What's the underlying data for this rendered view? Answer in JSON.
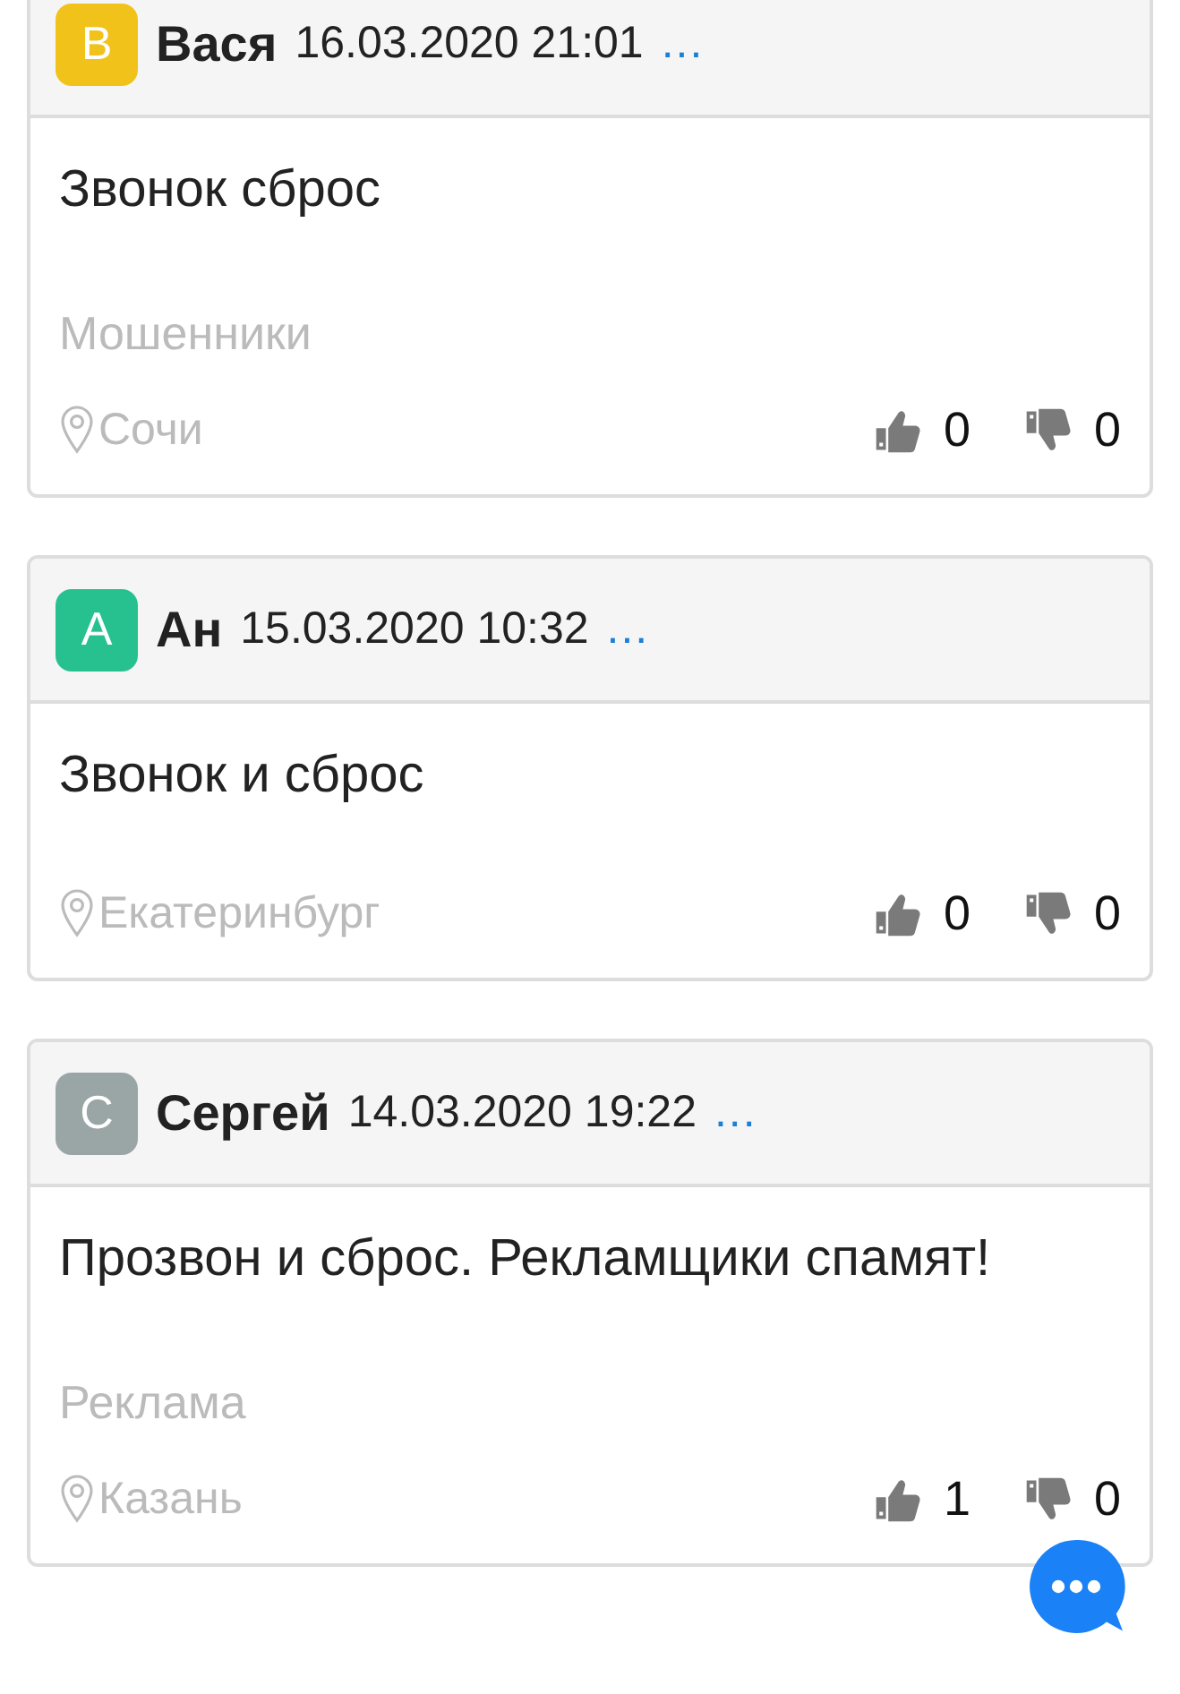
{
  "posts": [
    {
      "author": "Вася",
      "initial": "В",
      "color": "#f0c21a",
      "date": "16.03.2020 21:01",
      "more": "...",
      "text": "Звонок сброс",
      "category": "Мошенники",
      "location": "Сочи",
      "likes": "0",
      "dislikes": "0"
    },
    {
      "author": "Ан",
      "initial": "А",
      "color": "#27c190",
      "date": "15.03.2020 10:32",
      "more": "...",
      "text": "Звонок и сброс",
      "location": "Екатеринбург",
      "likes": "0",
      "dislikes": "0"
    },
    {
      "author": "Сергей",
      "initial": "С",
      "color": "#9aa6a5",
      "date": "14.03.2020 19:22",
      "more": "...",
      "text": "Прозвон и сброс. Рекламщики спамят!",
      "category": "Реклама",
      "location": "Казань",
      "likes": "1",
      "dislikes": "0"
    }
  ]
}
